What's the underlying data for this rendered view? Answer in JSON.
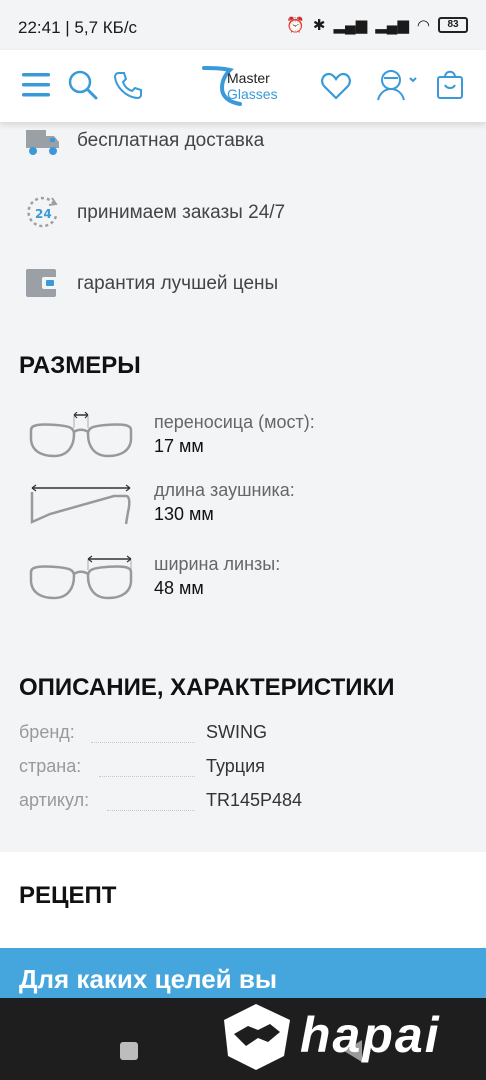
{
  "status_bar": {
    "text": "22:41 | 5,7 КБ/с",
    "battery": "83"
  },
  "header": {
    "logo_line1": "Master",
    "logo_line2": "Glasses",
    "accent_color": "#3a9ad9"
  },
  "benefits": [
    {
      "icon": "truck-icon",
      "text": "бесплатная доставка"
    },
    {
      "icon": "clock-24-icon",
      "text": "принимаем заказы 24/7"
    },
    {
      "icon": "wallet-icon",
      "text": "гарантия лучшей цены"
    }
  ],
  "sizes": {
    "title": "РАЗМЕРЫ",
    "items": [
      {
        "icon": "bridge-width-icon",
        "label": "переносица (мост):",
        "value": "17 мм"
      },
      {
        "icon": "temple-length-icon",
        "label": "длина заушника:",
        "value": "130 мм"
      },
      {
        "icon": "lens-width-icon",
        "label": "ширина линзы:",
        "value": "48 мм"
      }
    ]
  },
  "description": {
    "title": "ОПИСАНИЕ, ХАРАКТЕРИСТИКИ",
    "specs": [
      {
        "label": "бренд:",
        "value": "SWING"
      },
      {
        "label": "страна:",
        "value": "Турция"
      },
      {
        "label": "артикул:",
        "value": "TR145P484"
      }
    ]
  },
  "recipe": {
    "title": "РЕЦЕПТ"
  },
  "purpose_banner": {
    "text": "Для каких целей вы",
    "color": "#45a6dd"
  },
  "watermark": {
    "text": "hapai"
  }
}
